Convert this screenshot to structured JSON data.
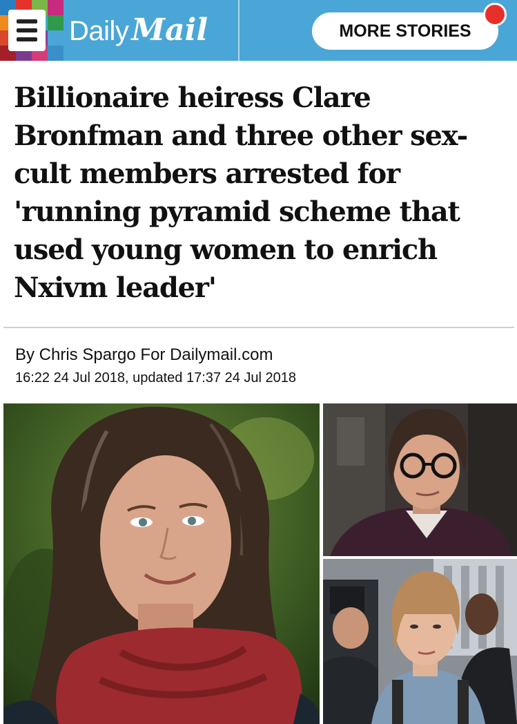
{
  "header": {
    "menu_icon": "hamburger-menu-icon",
    "brand_daily": "Daily",
    "brand_mail": "Mail",
    "more_stories_label": "MORE STORIES",
    "colors": {
      "header_bg": "#4aa6d6",
      "notification_dot": "#e8302b"
    }
  },
  "article": {
    "headline_lines": [
      "Billionaire heiress Clare",
      "Bronfman and three other sex-",
      "cult members arrested for",
      "'running pyramid scheme that",
      "used young women to enrich",
      "Nxivm leader'"
    ],
    "byline": "By Chris Spargo For Dailymail.com",
    "dateline": "16:22 24 Jul 2018, updated 17:37 24 Jul 2018"
  },
  "images": {
    "main": "portrait-woman-red-scarf",
    "top_right": "portrait-man-glasses",
    "bottom_right": "woman-in-crowd"
  }
}
